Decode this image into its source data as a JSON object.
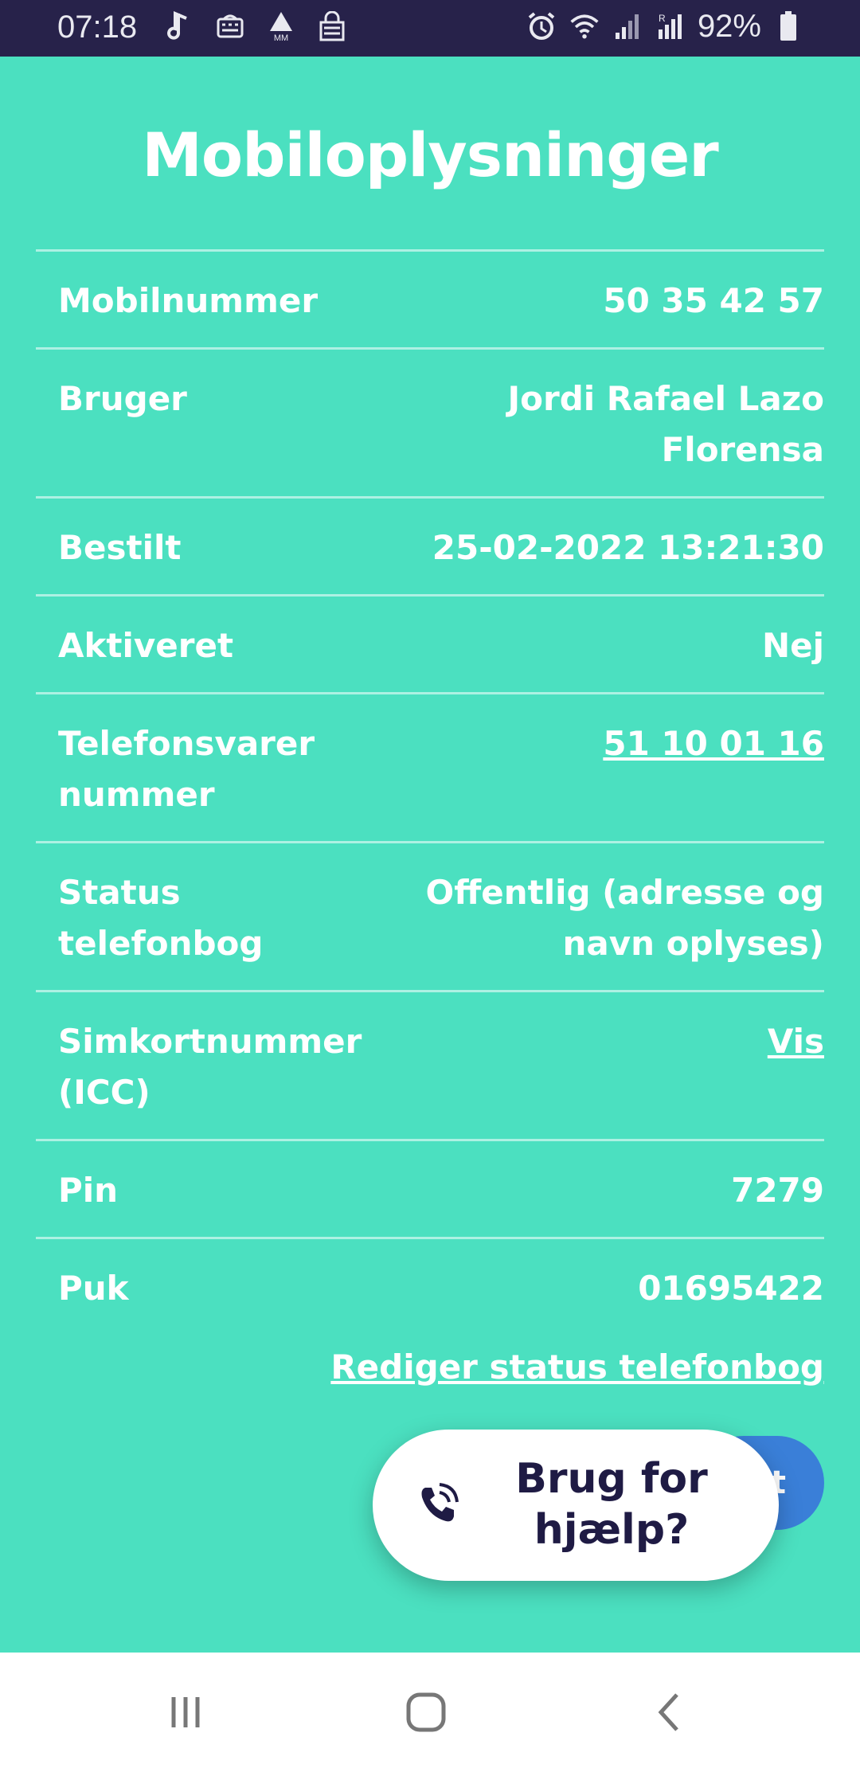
{
  "status_bar": {
    "time": "07:18",
    "left_icons": [
      "music-note-icon",
      "keyboard-icon",
      "mm-warning-icon",
      "lock-icon"
    ],
    "right_icons": [
      "alarm-icon",
      "wifi-icon",
      "signal-icon",
      "roaming-signal-icon"
    ],
    "battery": "92%"
  },
  "page": {
    "title": "Mobiloplysninger"
  },
  "rows": [
    {
      "label": "Mobilnummer",
      "value": "50 35 42 57"
    },
    {
      "label": "Bruger",
      "value": "Jordi Rafael Lazo Florensa"
    },
    {
      "label": "Bestilt",
      "value": "25-02-2022 13:21:30"
    },
    {
      "label": "Aktiveret",
      "value": "Nej"
    },
    {
      "label": "Telefonsvarer nummer",
      "value": "51 10 01 16"
    },
    {
      "label": "Status telefonbog",
      "value": "Offentlig (adresse og navn oplyses)"
    },
    {
      "label": "Simkortnummer (ICC)",
      "value": "Vis"
    },
    {
      "label": "Pin",
      "value": "7279"
    },
    {
      "label": "Puk",
      "value": "01695422"
    }
  ],
  "edit_link": "Rediger status telefonbog",
  "help": {
    "label": "Brug for hjælp?",
    "icon": "phone-call-icon"
  },
  "colors": {
    "background": "#4be0c0",
    "status_bar": "#27224a",
    "help_text": "#1f1b44",
    "blue_button": "#3a7fd8"
  },
  "nav_bar": {
    "icons": [
      "recents-icon",
      "home-icon",
      "back-icon"
    ]
  }
}
